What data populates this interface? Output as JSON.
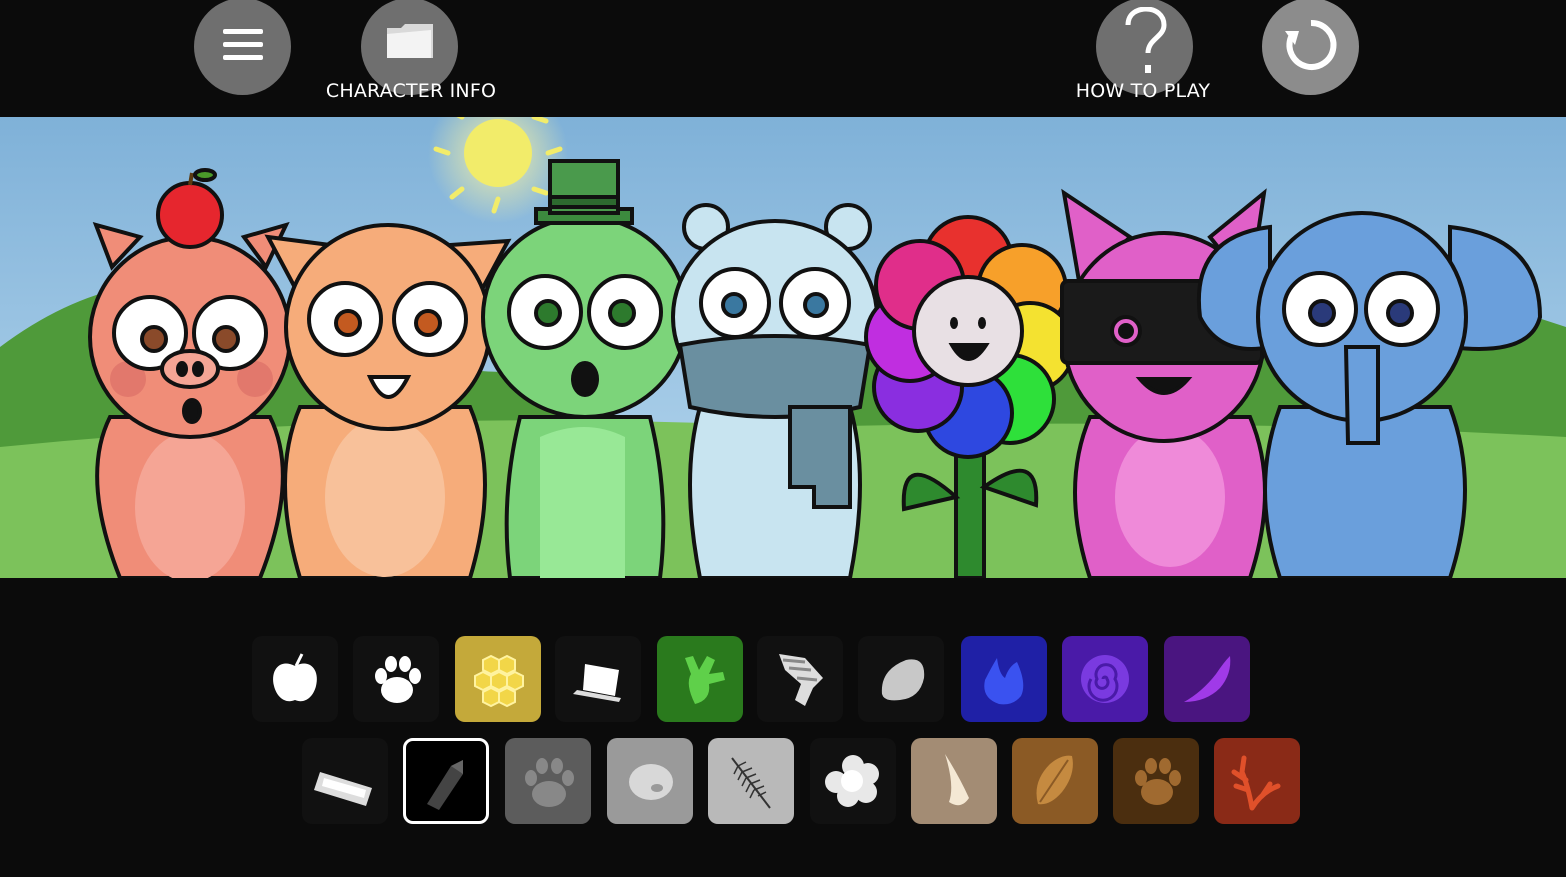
{
  "toolbar": {
    "menu_icon": "hamburger-menu-icon",
    "character_info_label": "CHARACTER INFO",
    "character_info_icon": "folder-icon",
    "how_to_play_label": "HOW TO PLAY",
    "how_to_play_icon": "question-mark-icon",
    "reset_icon": "restart-icon"
  },
  "scene": {
    "characters": [
      "pig",
      "cat",
      "lizard",
      "polar-bear",
      "flower",
      "pink-cat",
      "elephant"
    ],
    "props": [
      "sun",
      "apple",
      "top-hat",
      "scarf",
      "visor"
    ]
  },
  "palette": {
    "row1": [
      {
        "icon": "apple-icon",
        "color": "#111111",
        "selected": false
      },
      {
        "icon": "paw-icon",
        "color": "#111111",
        "selected": false
      },
      {
        "icon": "honeycomb-icon",
        "color": "#c4a93a",
        "selected": false
      },
      {
        "icon": "top-hat-icon",
        "color": "#111111",
        "selected": false
      },
      {
        "icon": "frog-foot-icon",
        "color": "#2a7a1d",
        "selected": false
      },
      {
        "icon": "scarf-icon",
        "color": "#111111",
        "selected": false
      },
      {
        "icon": "stone-icon",
        "color": "#111111",
        "selected": false
      },
      {
        "icon": "flame-icon",
        "color": "#1f20a6",
        "selected": false
      },
      {
        "icon": "spiral-icon",
        "color": "#4a1aa8",
        "selected": false
      },
      {
        "icon": "feather-icon",
        "color": "#4a1580",
        "selected": false
      }
    ],
    "row2": [
      {
        "icon": "visor-icon",
        "color": "#111111",
        "selected": false
      },
      {
        "icon": "crystal-icon",
        "color": "#000000",
        "selected": true
      },
      {
        "icon": "claw-paw-icon",
        "color": "#5c5c5c",
        "selected": false
      },
      {
        "icon": "egg-icon",
        "color": "#9a9a9a",
        "selected": false
      },
      {
        "icon": "fern-leaf-icon",
        "color": "#b9b9b9",
        "selected": false
      },
      {
        "icon": "cloud-flower-icon",
        "color": "#111111",
        "selected": false
      },
      {
        "icon": "horn-icon",
        "color": "#a38c74",
        "selected": false
      },
      {
        "icon": "leaf-icon",
        "color": "#8b5a25",
        "selected": false
      },
      {
        "icon": "bear-paw-icon",
        "color": "#4b2e0f",
        "selected": false
      },
      {
        "icon": "antler-icon",
        "color": "#8a2a17",
        "selected": false
      }
    ]
  }
}
